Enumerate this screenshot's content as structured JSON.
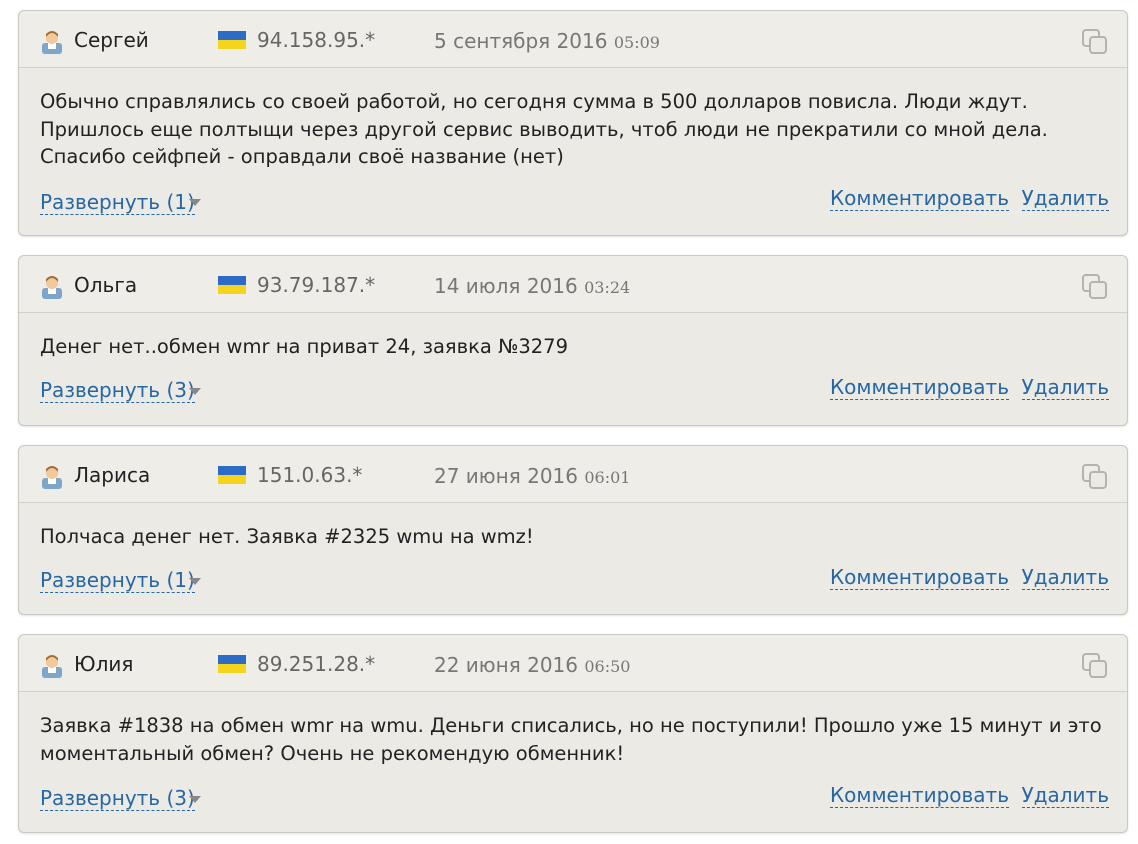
{
  "comments": [
    {
      "author": "Сергей",
      "ip": "94.158.95.*",
      "date": "5 сентября 2016",
      "time": "05:09",
      "text": "Обычно справлялись со своей работой, но сегодня сумма в 500 долларов повисла. Люди ждут.\nПришлось еще полтыщи через другой сервис выводить, чтоб люди не прекратили со мной дела.\nСпасибо сейфпей - оправдали своё название (нет)",
      "expand_label": "Развернуть (1)",
      "comment_label": "Комментировать",
      "delete_label": "Удалить"
    },
    {
      "author": "Ольга",
      "ip": "93.79.187.*",
      "date": "14 июля 2016",
      "time": "03:24",
      "text": "Денег нет..обмен wmr на приват 24, заявка №3279",
      "expand_label": "Развернуть (3)",
      "comment_label": "Комментировать",
      "delete_label": "Удалить"
    },
    {
      "author": "Лариса",
      "ip": "151.0.63.*",
      "date": "27 июня 2016",
      "time": "06:01",
      "text": "Полчаса денег нет. Заявка #2325 wmu на wmz!",
      "expand_label": "Развернуть (1)",
      "comment_label": "Комментировать",
      "delete_label": "Удалить"
    },
    {
      "author": "Юлия",
      "ip": "89.251.28.*",
      "date": "22 июня 2016",
      "time": "06:50",
      "text": "Заявка #1838 на обмен wmr на wmu. Деньги списались, но не поступили! Прошло уже 15 минут и это\nмоментальный обмен? Очень не рекомендую обменник!",
      "expand_label": "Развернуть (3)",
      "comment_label": "Комментировать",
      "delete_label": "Удалить"
    }
  ],
  "colors": {
    "card_bg": "#ebeae4",
    "link": "#2667a4",
    "flag_blue": "#2e6bc6",
    "flag_yellow": "#f4d41d"
  },
  "icons": {
    "avatar": "user-avatar-icon",
    "flag": "ukraine-flag-icon",
    "copy": "copy-icon",
    "expand_arrow": "triangle-down-icon"
  }
}
